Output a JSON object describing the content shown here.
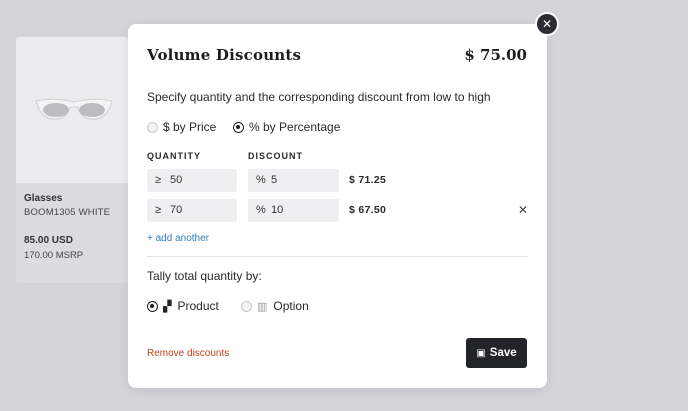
{
  "product": {
    "name": "Glasses",
    "sku": "BOOM1305 WHITE",
    "price": "85.00 USD",
    "msrp": "170.00 MSRP"
  },
  "modal": {
    "title": "Volume Discounts",
    "price": "$ 75.00",
    "instructions": "Specify quantity and the corresponding discount from low to high",
    "discount_type": {
      "options": [
        {
          "label": "$ by Price",
          "selected": false
        },
        {
          "label": "% by Percentage",
          "selected": true
        }
      ]
    },
    "columns": {
      "quantity": "QUANTITY",
      "discount": "DISCOUNT"
    },
    "tiers": [
      {
        "qty_prefix": "≥",
        "quantity": "50",
        "disc_prefix": "%",
        "discount": "5",
        "total": "$ 71.25",
        "removable": false
      },
      {
        "qty_prefix": "≥",
        "quantity": "70",
        "disc_prefix": "%",
        "discount": "10",
        "total": "$ 67.50",
        "removable": true
      }
    ],
    "add_another": "+ add another",
    "tally_label": "Tally total quantity by:",
    "tally_options": [
      {
        "label": "Product",
        "icon": "product-icon",
        "selected": true
      },
      {
        "label": "Option",
        "icon": "option-icon",
        "selected": false
      }
    ],
    "remove_discounts": "Remove discounts",
    "save_label": "Save",
    "close_glyph": "✕",
    "remove_glyph": "✕"
  },
  "colors": {
    "backdrop": "#d4d3d8",
    "primary_button": "#23232a",
    "link_blue": "#2e7dbd",
    "danger_red": "#c0441f"
  }
}
